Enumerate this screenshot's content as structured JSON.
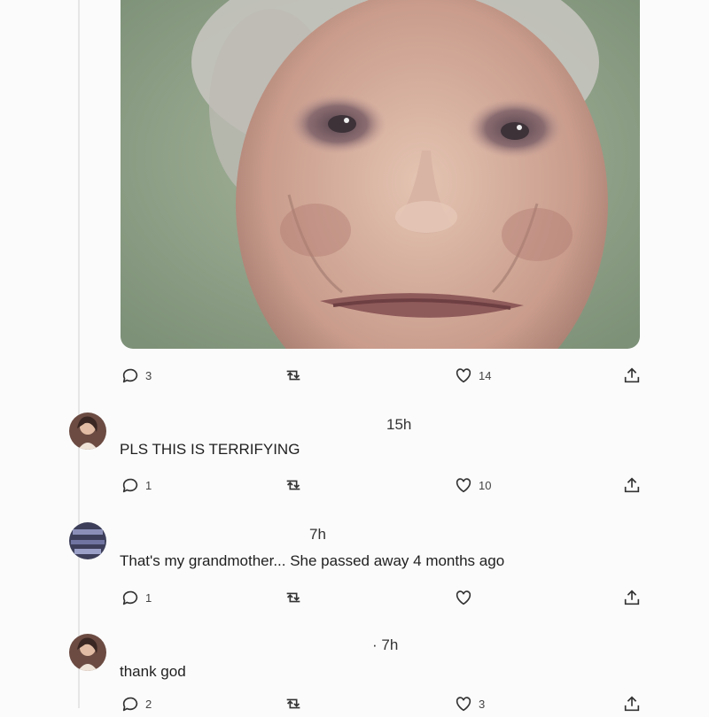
{
  "post": {
    "reply_count": "3",
    "like_count": "14"
  },
  "replies": [
    {
      "time": "15h",
      "text": "PLS THIS IS TERRIFYING",
      "reply_count": "1",
      "like_count": "10"
    },
    {
      "time": "7h",
      "text": "That's my grandmother... She passed away 4 months ago",
      "reply_count": "1",
      "like_count": ""
    },
    {
      "time": "· 7h",
      "text": "thank god",
      "reply_count": "2",
      "like_count": "3"
    }
  ],
  "icons": {
    "reply": "speech-bubble-icon",
    "retweet": "retweet-icon",
    "like": "heart-icon",
    "share": "share-icon"
  }
}
